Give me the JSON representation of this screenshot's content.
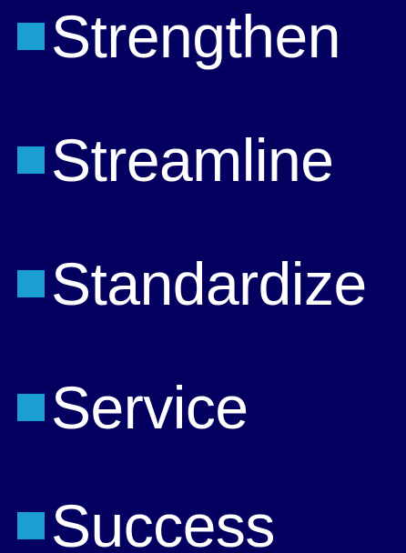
{
  "colors": {
    "background": "#03005f",
    "bullet": "#1a9fd0",
    "text": "#ffffff"
  },
  "bullets": [
    {
      "label": "Strengthen"
    },
    {
      "label": "Streamline"
    },
    {
      "label": "Standardize"
    },
    {
      "label": "Service"
    },
    {
      "label": "Success"
    }
  ]
}
